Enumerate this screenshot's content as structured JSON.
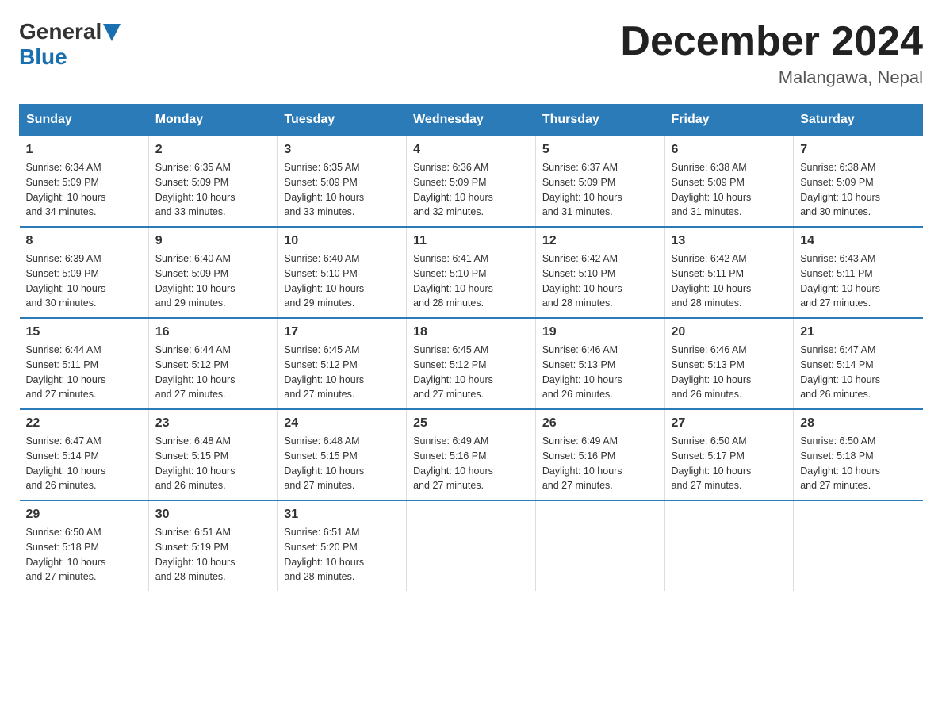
{
  "header": {
    "logo_general": "General",
    "logo_blue": "Blue",
    "title": "December 2024",
    "subtitle": "Malangawa, Nepal"
  },
  "days_of_week": [
    "Sunday",
    "Monday",
    "Tuesday",
    "Wednesday",
    "Thursday",
    "Friday",
    "Saturday"
  ],
  "weeks": [
    [
      {
        "day": "1",
        "sunrise": "6:34 AM",
        "sunset": "5:09 PM",
        "daylight": "10 hours and 34 minutes."
      },
      {
        "day": "2",
        "sunrise": "6:35 AM",
        "sunset": "5:09 PM",
        "daylight": "10 hours and 33 minutes."
      },
      {
        "day": "3",
        "sunrise": "6:35 AM",
        "sunset": "5:09 PM",
        "daylight": "10 hours and 33 minutes."
      },
      {
        "day": "4",
        "sunrise": "6:36 AM",
        "sunset": "5:09 PM",
        "daylight": "10 hours and 32 minutes."
      },
      {
        "day": "5",
        "sunrise": "6:37 AM",
        "sunset": "5:09 PM",
        "daylight": "10 hours and 31 minutes."
      },
      {
        "day": "6",
        "sunrise": "6:38 AM",
        "sunset": "5:09 PM",
        "daylight": "10 hours and 31 minutes."
      },
      {
        "day": "7",
        "sunrise": "6:38 AM",
        "sunset": "5:09 PM",
        "daylight": "10 hours and 30 minutes."
      }
    ],
    [
      {
        "day": "8",
        "sunrise": "6:39 AM",
        "sunset": "5:09 PM",
        "daylight": "10 hours and 30 minutes."
      },
      {
        "day": "9",
        "sunrise": "6:40 AM",
        "sunset": "5:09 PM",
        "daylight": "10 hours and 29 minutes."
      },
      {
        "day": "10",
        "sunrise": "6:40 AM",
        "sunset": "5:10 PM",
        "daylight": "10 hours and 29 minutes."
      },
      {
        "day": "11",
        "sunrise": "6:41 AM",
        "sunset": "5:10 PM",
        "daylight": "10 hours and 28 minutes."
      },
      {
        "day": "12",
        "sunrise": "6:42 AM",
        "sunset": "5:10 PM",
        "daylight": "10 hours and 28 minutes."
      },
      {
        "day": "13",
        "sunrise": "6:42 AM",
        "sunset": "5:11 PM",
        "daylight": "10 hours and 28 minutes."
      },
      {
        "day": "14",
        "sunrise": "6:43 AM",
        "sunset": "5:11 PM",
        "daylight": "10 hours and 27 minutes."
      }
    ],
    [
      {
        "day": "15",
        "sunrise": "6:44 AM",
        "sunset": "5:11 PM",
        "daylight": "10 hours and 27 minutes."
      },
      {
        "day": "16",
        "sunrise": "6:44 AM",
        "sunset": "5:12 PM",
        "daylight": "10 hours and 27 minutes."
      },
      {
        "day": "17",
        "sunrise": "6:45 AM",
        "sunset": "5:12 PM",
        "daylight": "10 hours and 27 minutes."
      },
      {
        "day": "18",
        "sunrise": "6:45 AM",
        "sunset": "5:12 PM",
        "daylight": "10 hours and 27 minutes."
      },
      {
        "day": "19",
        "sunrise": "6:46 AM",
        "sunset": "5:13 PM",
        "daylight": "10 hours and 26 minutes."
      },
      {
        "day": "20",
        "sunrise": "6:46 AM",
        "sunset": "5:13 PM",
        "daylight": "10 hours and 26 minutes."
      },
      {
        "day": "21",
        "sunrise": "6:47 AM",
        "sunset": "5:14 PM",
        "daylight": "10 hours and 26 minutes."
      }
    ],
    [
      {
        "day": "22",
        "sunrise": "6:47 AM",
        "sunset": "5:14 PM",
        "daylight": "10 hours and 26 minutes."
      },
      {
        "day": "23",
        "sunrise": "6:48 AM",
        "sunset": "5:15 PM",
        "daylight": "10 hours and 26 minutes."
      },
      {
        "day": "24",
        "sunrise": "6:48 AM",
        "sunset": "5:15 PM",
        "daylight": "10 hours and 27 minutes."
      },
      {
        "day": "25",
        "sunrise": "6:49 AM",
        "sunset": "5:16 PM",
        "daylight": "10 hours and 27 minutes."
      },
      {
        "day": "26",
        "sunrise": "6:49 AM",
        "sunset": "5:16 PM",
        "daylight": "10 hours and 27 minutes."
      },
      {
        "day": "27",
        "sunrise": "6:50 AM",
        "sunset": "5:17 PM",
        "daylight": "10 hours and 27 minutes."
      },
      {
        "day": "28",
        "sunrise": "6:50 AM",
        "sunset": "5:18 PM",
        "daylight": "10 hours and 27 minutes."
      }
    ],
    [
      {
        "day": "29",
        "sunrise": "6:50 AM",
        "sunset": "5:18 PM",
        "daylight": "10 hours and 27 minutes."
      },
      {
        "day": "30",
        "sunrise": "6:51 AM",
        "sunset": "5:19 PM",
        "daylight": "10 hours and 28 minutes."
      },
      {
        "day": "31",
        "sunrise": "6:51 AM",
        "sunset": "5:20 PM",
        "daylight": "10 hours and 28 minutes."
      },
      null,
      null,
      null,
      null
    ]
  ],
  "labels": {
    "sunrise": "Sunrise:",
    "sunset": "Sunset:",
    "daylight": "Daylight:"
  }
}
